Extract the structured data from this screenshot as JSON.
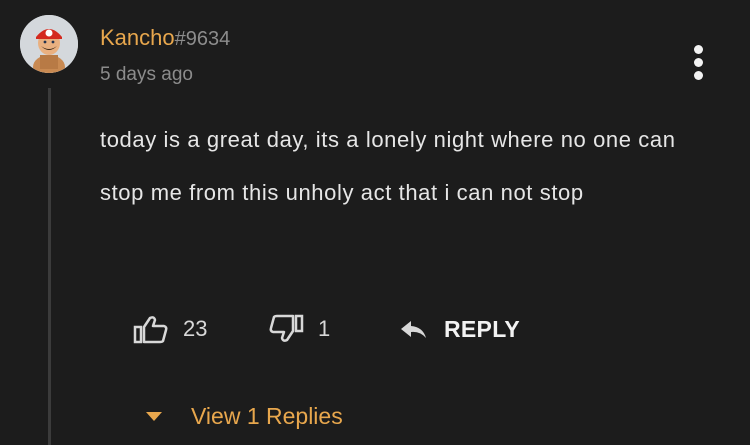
{
  "comment": {
    "author": {
      "username": "Kancho",
      "discriminator": "#9634",
      "avatar": "mario-character-avatar"
    },
    "timestamp": "5 days ago",
    "body": "today is a great day, its a lonely night where no one can stop me from this unholy act that i can not stop",
    "upvotes": "23",
    "downvotes": "1",
    "reply_label": "REPLY",
    "view_replies_label": "View 1 Replies"
  },
  "icons": {
    "more": "vertical-dots-icon",
    "upvote": "thumbs-up-icon",
    "downvote": "thumbs-down-icon",
    "reply": "reply-arrow-icon",
    "expand": "caret-down-icon"
  },
  "colors": {
    "background": "#1c1c1c",
    "username": "#e8a74d",
    "muted": "#8c8c8c",
    "text": "#e6e6e6",
    "accent": "#e8a74d"
  }
}
